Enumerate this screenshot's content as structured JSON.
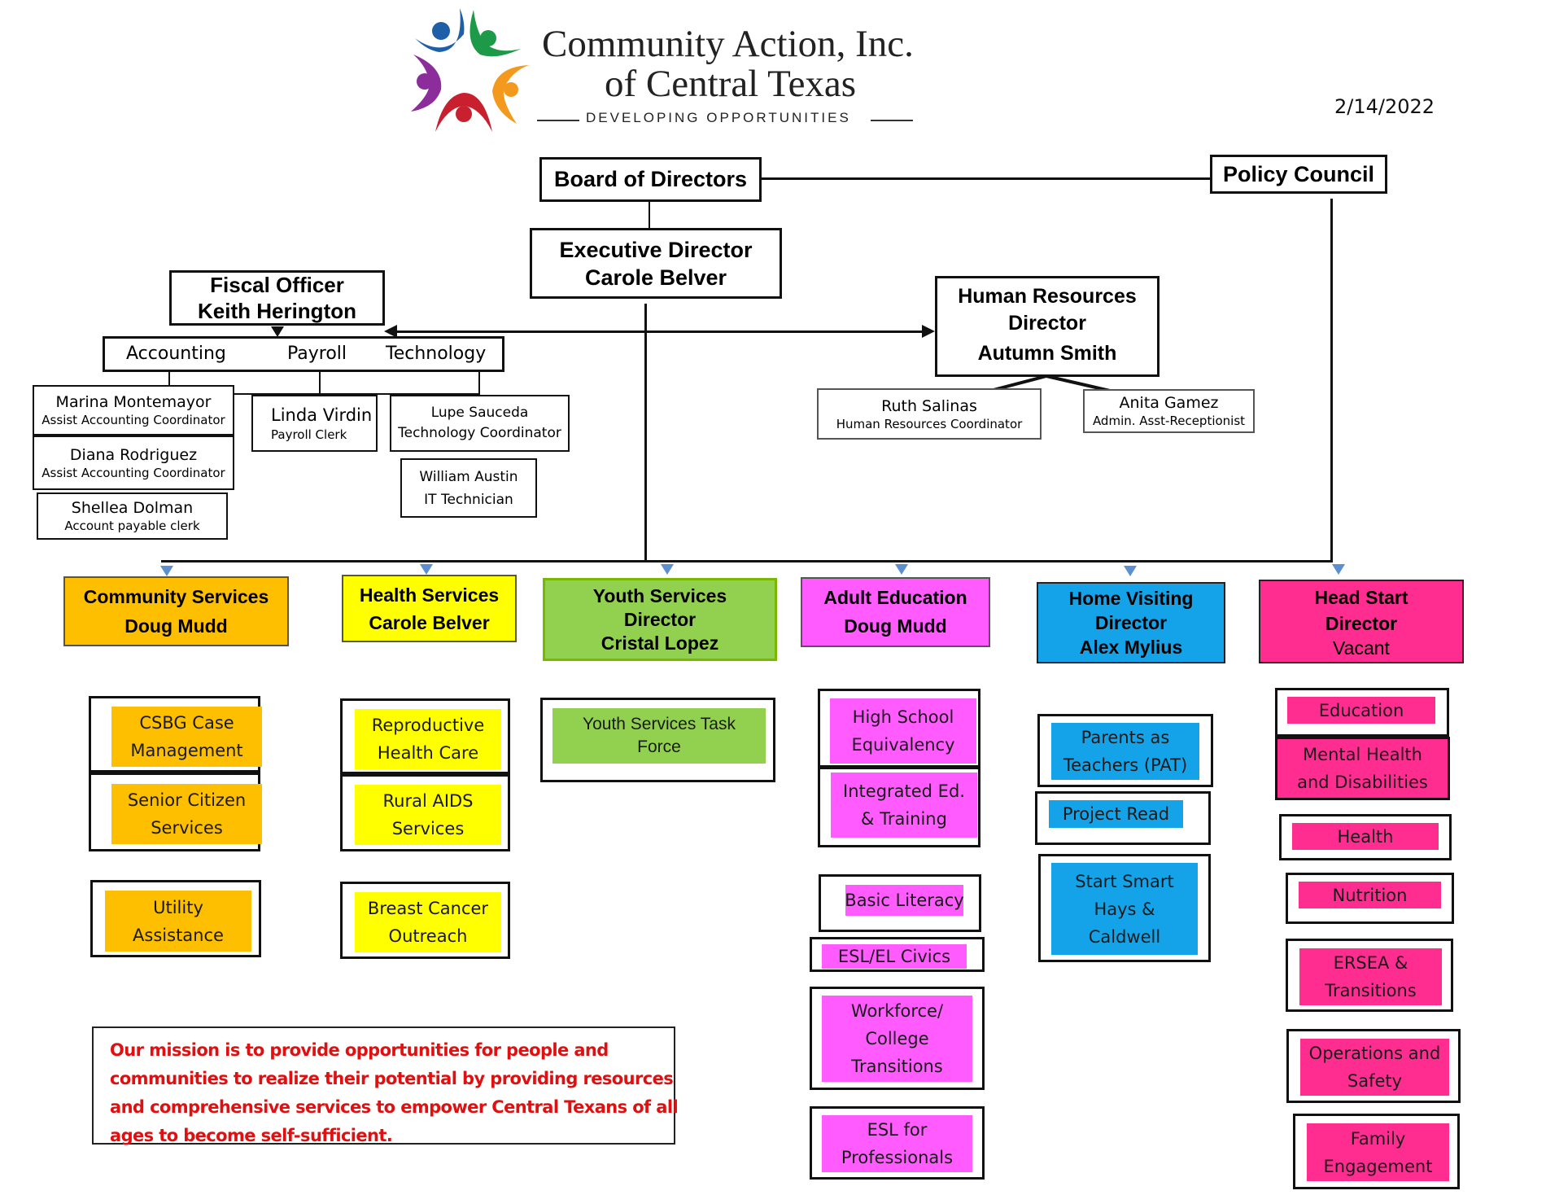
{
  "header": {
    "org_name_line1": "Community Action, Inc.",
    "org_name_line2": "of Central Texas",
    "tagline": "Developing Opportunities",
    "date": "2/14/2022",
    "logo_colors": [
      "#1f5fa8",
      "#1c9a48",
      "#f39a1e",
      "#c8202f",
      "#8b2d9b"
    ]
  },
  "governance": {
    "board": "Board of Directors",
    "policy_council": "Policy Council",
    "executive": {
      "title": "Executive Director",
      "name": "Carole Belver"
    }
  },
  "fiscal": {
    "title": "Fiscal Officer",
    "name": "Keith Herington",
    "departments": [
      "Accounting",
      "Payroll",
      "Technology"
    ],
    "staff": [
      {
        "name": "Marina Montemayor",
        "title": "Assist Accounting Coordinator"
      },
      {
        "name": "Diana Rodriguez",
        "title": "Assist Accounting Coordinator"
      },
      {
        "name": "Shellea Dolman",
        "title": "Account payable clerk"
      },
      {
        "name": "Linda Virdin",
        "title": "Payroll Clerk"
      },
      {
        "name": "Lupe Sauceda",
        "title": "Technology Coordinator"
      },
      {
        "name": "William Austin",
        "title": "IT Technician"
      }
    ]
  },
  "hr": {
    "title_line1": "Human Resources",
    "title_line2": "Director",
    "name": "Autumn Smith",
    "staff": [
      {
        "name": "Ruth Salinas",
        "title": "Human Resources Coordinator"
      },
      {
        "name": "Anita Gamez",
        "title": "Admin. Asst-Receptionist"
      }
    ]
  },
  "divisions": [
    {
      "key": "community",
      "title": "Community Services",
      "name": "Doug Mudd",
      "color": "#fdbf00",
      "programs": [
        [
          "CSBG Case",
          "Management"
        ],
        [
          "Senior Citizen",
          "Services"
        ],
        [
          "Utility",
          "Assistance"
        ]
      ]
    },
    {
      "key": "health",
      "title": "Health Services",
      "name": "Carole Belver",
      "color": "#ffff00",
      "programs": [
        [
          "Reproductive",
          "Health Care"
        ],
        [
          "Rural AIDS",
          "Services"
        ],
        [
          "Breast Cancer",
          "Outreach"
        ]
      ]
    },
    {
      "key": "youth",
      "title": "Youth Services",
      "subtitle": "Director",
      "name": "Cristal Lopez",
      "color": "#92d050",
      "border": "#7ab800",
      "programs": [
        [
          "Youth Services Task",
          "Force"
        ]
      ]
    },
    {
      "key": "adult",
      "title": "Adult Education",
      "name": "Doug Mudd",
      "color": "#ff5bff",
      "programs": [
        [
          "High School",
          "Equivalency"
        ],
        [
          "Integrated Ed.",
          "& Training"
        ],
        [
          "Basic Literacy"
        ],
        [
          "ESL/EL Civics"
        ],
        [
          "Workforce/",
          "College",
          "Transitions"
        ],
        [
          "ESL for",
          "Professionals"
        ]
      ]
    },
    {
      "key": "home",
      "title": "Home Visiting",
      "subtitle": "Director",
      "name": "Alex Mylius",
      "color": "#14a3e8",
      "programs": [
        [
          "Parents as",
          "Teachers (PAT)"
        ],
        [
          "Project Read"
        ],
        [
          "Start Smart",
          "Hays &",
          "Caldwell"
        ]
      ]
    },
    {
      "key": "headstart",
      "title": "Head Start",
      "subtitle": "Director",
      "name": "Vacant",
      "color": "#ff2d8f",
      "programs": [
        [
          "Education"
        ],
        [
          "Mental Health",
          "and Disabilities"
        ],
        [
          "Health"
        ],
        [
          "Nutrition"
        ],
        [
          "ERSEA &",
          "Transitions"
        ],
        [
          "Operations and",
          "Safety"
        ],
        [
          "Family",
          "Engagement"
        ]
      ]
    }
  ],
  "mission": {
    "lines": [
      "Our mission is to provide opportunities for people and",
      "communities to realize their potential by providing resources",
      "and comprehensive services to empower Central Texans of all",
      "ages to become self-sufficient."
    ],
    "color": "#e01010"
  }
}
